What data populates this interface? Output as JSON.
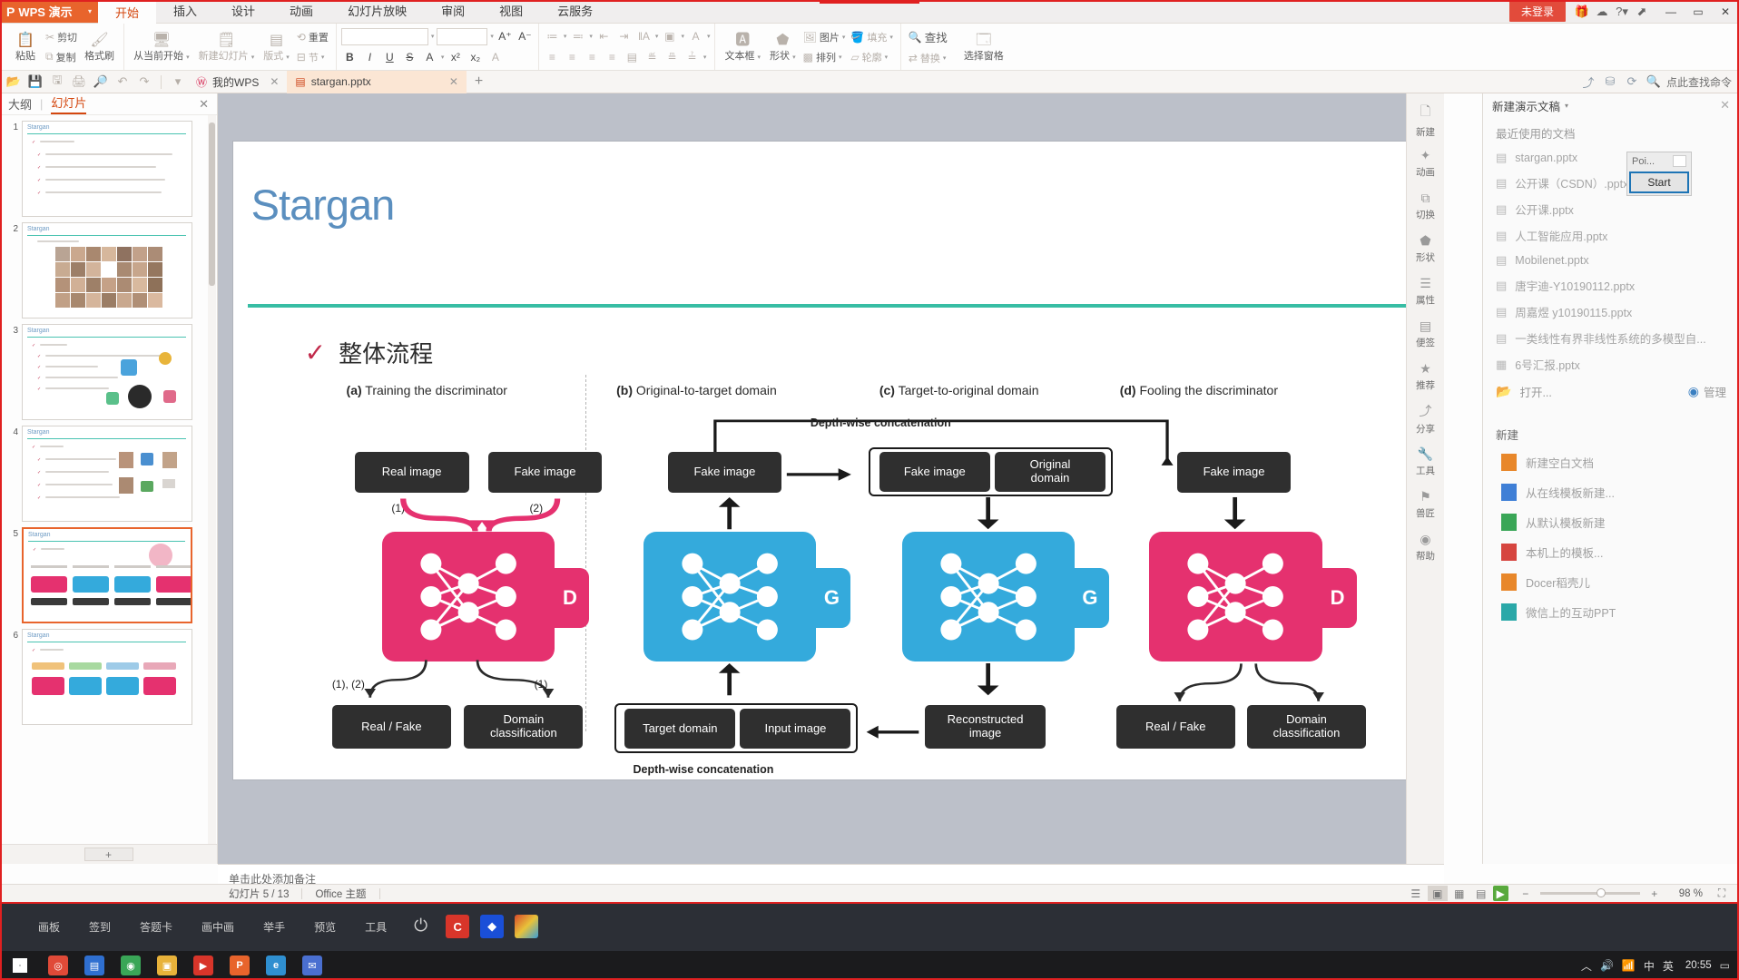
{
  "titlebar": {
    "app_name": "WPS 演示",
    "logo_glyph": "P",
    "dropdown_caret": "▾",
    "tabs": [
      {
        "label": "开始",
        "active": true
      },
      {
        "label": "插入",
        "active": false
      },
      {
        "label": "设计",
        "active": false
      },
      {
        "label": "动画",
        "active": false
      },
      {
        "label": "幻灯片放映",
        "active": false
      },
      {
        "label": "审阅",
        "active": false
      },
      {
        "label": "视图",
        "active": false
      },
      {
        "label": "云服务",
        "active": false
      }
    ],
    "login_label": "未登录",
    "right_icons": [
      "gift-icon",
      "cloud-sync-icon",
      "help-icon",
      "restore-window-icon"
    ],
    "window_buttons": {
      "minimize": "—",
      "maximize": "▭",
      "close": "✕"
    }
  },
  "ribbon": {
    "clipboard": {
      "paste_label": "粘贴",
      "cut_label": "剪切",
      "copy_label": "复制",
      "format_painter_label": "格式刷"
    },
    "slides": {
      "from_current_label": "从当前开始",
      "new_slide_label": "新建幻灯片",
      "layout_label": "版式",
      "section_label": "节",
      "reset_label": "重置"
    },
    "font": {
      "font_family_value": "",
      "font_size_value": "",
      "grow_font": "A",
      "shrink_font": "A",
      "bold": "B",
      "italic": "I",
      "underline": "U",
      "strikethrough": "S",
      "text_color": "A",
      "superscript": "x²",
      "subscript": "x₂",
      "clear_format": "A"
    },
    "paragraph": {
      "bullets": "≔",
      "numbering": "≕",
      "decrease_indent": "⇤",
      "increase_indent": "⇥",
      "line_spacing": "‖A",
      "text_direction": "▣",
      "align_text": "A",
      "align_left": "≡",
      "align_center": "≡",
      "align_right": "≡",
      "align_justify": "≡",
      "columns": "▤",
      "smartart1": "≝",
      "smartart2": "≞",
      "smartart3": "≟"
    },
    "insert": {
      "textbox_label": "文本框",
      "shape_label": "形状",
      "picture_label": "图片",
      "fill_label": "填充",
      "arrange_label": "排列",
      "outline_label": "轮廓"
    },
    "edit": {
      "find_label": "查找",
      "replace_label": "替换",
      "select_pane_label": "选择窗格"
    }
  },
  "quickbar": {
    "icons": [
      "open-folder-icon",
      "save-icon",
      "save-as-icon",
      "print-icon",
      "print-preview-icon",
      "undo-icon",
      "redo-icon",
      "customize-caret-icon"
    ],
    "tabs": [
      {
        "label": "我的WPS",
        "icon": "wps-w-icon",
        "active": false,
        "closable": true
      },
      {
        "label": "stargan.pptx",
        "icon": "pptx-file-icon",
        "active": true,
        "closable": true
      }
    ],
    "new_tab": "+",
    "right_icons": [
      "share-icon",
      "cowork-icon",
      "backup-icon",
      "search-icon"
    ],
    "search_label": "点此查找命令"
  },
  "left_panel": {
    "tab_outline": "大纲",
    "tab_slides": "幻灯片",
    "divider": "|",
    "close": "✕",
    "add_slide": "+",
    "thumbnails": [
      {
        "number": "1",
        "title": "Stargan",
        "selected": false
      },
      {
        "number": "2",
        "title": "Stargan",
        "selected": false
      },
      {
        "number": "3",
        "title": "Stargan",
        "selected": false
      },
      {
        "number": "4",
        "title": "Stargan",
        "selected": false
      },
      {
        "number": "5",
        "title": "Stargan",
        "selected": true
      },
      {
        "number": "6",
        "title": "Stargan",
        "selected": false
      }
    ]
  },
  "slide": {
    "title": "Stargan",
    "section_check": "✓",
    "section_heading": "整体流程",
    "diagram": {
      "panels": [
        {
          "tag": "(a)",
          "label": "Training the discriminator"
        },
        {
          "tag": "(b)",
          "label": "Original-to-target domain"
        },
        {
          "tag": "(c)",
          "label": "Target-to-original domain"
        },
        {
          "tag": "(d)",
          "label": "Fooling the discriminator"
        }
      ],
      "depth_concat_top": "Depth-wise concatenation",
      "depth_concat_bottom": "Depth-wise concatenation",
      "a": {
        "real_image": "Real image",
        "fake_image": "Fake image",
        "mark1": "(1)",
        "mark2": "(2)",
        "net_letter": "D",
        "mark3": "(1), (2)",
        "mark4": "(1)",
        "real_fake": "Real / Fake",
        "domain_class": "Domain\nclassification"
      },
      "b": {
        "fake_image": "Fake image",
        "net_letter": "G",
        "target_domain": "Target domain",
        "input_image": "Input image"
      },
      "c": {
        "fake_image": "Fake image",
        "original_domain": "Original\ndomain",
        "net_letter": "G",
        "reconstructed": "Reconstructed\nimage"
      },
      "d": {
        "fake_image": "Fake image",
        "net_letter": "D",
        "real_fake": "Real / Fake",
        "domain_class": "Domain\nclassification"
      }
    }
  },
  "notes": {
    "placeholder": "单击此处添加备注"
  },
  "vtools": [
    {
      "label": "新建",
      "icon": "new-doc-icon"
    },
    {
      "label": "动画",
      "icon": "animation-icon"
    },
    {
      "label": "切换",
      "icon": "transition-icon"
    },
    {
      "label": "形状",
      "icon": "shape-icon"
    },
    {
      "label": "属性",
      "icon": "properties-icon"
    },
    {
      "label": "便签",
      "icon": "sticky-note-icon"
    },
    {
      "label": "推荐",
      "icon": "recommend-icon"
    },
    {
      "label": "分享",
      "icon": "share-icon"
    },
    {
      "label": "工具",
      "icon": "tools-icon"
    },
    {
      "label": "兽匠",
      "icon": "plugin-icon"
    },
    {
      "label": "帮助",
      "icon": "help-icon"
    }
  ],
  "right_panel": {
    "header": "新建演示文稿",
    "header_caret": "▾",
    "close": "✕",
    "recent_label": "最近使用的文档",
    "recent_files": [
      {
        "name": "stargan.pptx",
        "icon": "pptx-file-icon"
      },
      {
        "name": "公开课（CSDN）.pptx",
        "icon": "pptx-file-icon"
      },
      {
        "name": "公开课.pptx",
        "icon": "pptx-file-icon"
      },
      {
        "name": "人工智能应用.pptx",
        "icon": "pptx-file-icon"
      },
      {
        "name": "Mobilenet.pptx",
        "icon": "pptx-file-icon"
      },
      {
        "name": "唐宇迪-Y10190112.pptx",
        "icon": "pptx-file-icon"
      },
      {
        "name": "周嘉煜 y10190115.pptx",
        "icon": "pptx-file-icon"
      },
      {
        "name": "一类线性有界非线性系统的多模型自...",
        "icon": "pptx-file-icon"
      },
      {
        "name": "6号汇报.pptx",
        "icon": "chart-file-icon"
      }
    ],
    "open_label": "打开...",
    "manage_label": "管理",
    "new_label": "新建",
    "new_items": [
      {
        "label": "新建空白文档",
        "icon": "blank-doc-icon",
        "color": "org"
      },
      {
        "label": "从在线模板新建...",
        "icon": "online-template-icon",
        "color": "blue"
      },
      {
        "label": "从默认模板新建",
        "icon": "default-template-icon",
        "color": "grn"
      },
      {
        "label": "本机上的模板...",
        "icon": "local-template-icon",
        "color": "red"
      },
      {
        "label": "Docer稻壳儿",
        "icon": "docer-icon",
        "color": "org"
      },
      {
        "label": "微信上的互动PPT",
        "icon": "wechat-ppt-icon",
        "color": "teal"
      }
    ]
  },
  "popup": {
    "title": "Poi...",
    "button": "Start"
  },
  "statusbar": {
    "slide_counter": "幻灯片 5 / 13",
    "theme": "Office 主题",
    "view_icons": [
      "normal-view-icon",
      "slide-sorter-icon",
      "reading-view-icon",
      "play-icon"
    ],
    "zoom_out": "−",
    "zoom_in": "+",
    "zoom_value": "98 %",
    "fit_icon": "⛶"
  },
  "dock": {
    "items": [
      {
        "label": "画板",
        "icon": "whiteboard-icon"
      },
      {
        "label": "签到",
        "icon": "checkin-icon"
      },
      {
        "label": "答题卡",
        "icon": "answer-card-icon"
      },
      {
        "label": "画中画",
        "icon": "pip-icon"
      },
      {
        "label": "举手",
        "icon": "raise-hand-icon"
      },
      {
        "label": "预览",
        "icon": "preview-icon"
      },
      {
        "label": "工具",
        "icon": "tools-icon"
      }
    ],
    "power": "⏻",
    "apps": [
      {
        "name": "app-red-icon",
        "glyph": "C",
        "color": "#d8352a"
      },
      {
        "name": "app-blue-icon",
        "glyph": "◆",
        "color": "#1a4fd8"
      },
      {
        "name": "app-rainbow-icon",
        "glyph": "▨",
        "color": "#c07a38"
      }
    ]
  },
  "taskbar": {
    "apps": [
      {
        "name": "app-chrome-icon",
        "glyph": "◎",
        "color": "#e04a38"
      },
      {
        "name": "app-store-icon",
        "glyph": "▤",
        "color": "#2f6fd0"
      },
      {
        "name": "app-wechat-icon",
        "glyph": "💬",
        "color": "#3aa657"
      },
      {
        "name": "app-folder-icon",
        "glyph": "▣",
        "color": "#e8b23a"
      },
      {
        "name": "app-video-icon",
        "glyph": "▶",
        "color": "#d8352a"
      },
      {
        "name": "app-wps-icon",
        "glyph": "P",
        "color": "#e8642c"
      },
      {
        "name": "app-edge-icon",
        "glyph": "e",
        "color": "#2f8fd0"
      },
      {
        "name": "app-mail-icon",
        "glyph": "✉",
        "color": "#4a6fd0"
      }
    ],
    "tray_icons": [
      "up-arrow-icon",
      "volume-icon",
      "network-icon",
      "ime-icon",
      "language-icon",
      "notification-icon"
    ],
    "ime_label": "中",
    "lang_label": "英",
    "clock": "20:55"
  }
}
